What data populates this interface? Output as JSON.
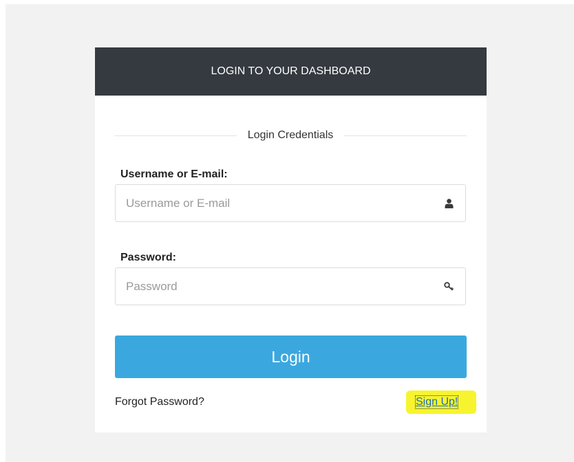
{
  "header": {
    "title": "LOGIN TO YOUR DASHBOARD"
  },
  "form": {
    "section_title": "Login Credentials",
    "username": {
      "label": "Username or E-mail:",
      "placeholder": "Username or E-mail",
      "value": "",
      "icon": "user-icon"
    },
    "password": {
      "label": "Password:",
      "placeholder": "Password",
      "value": "",
      "icon": "key-icon"
    },
    "login_button_label": "Login",
    "forgot_password_label": "Forgot Password?",
    "signup_label": "Sign Up!"
  },
  "colors": {
    "header_bg": "#343a40",
    "button_bg": "#3aa8df",
    "page_bg": "#f2f2f2",
    "highlight": "#f7f324"
  }
}
